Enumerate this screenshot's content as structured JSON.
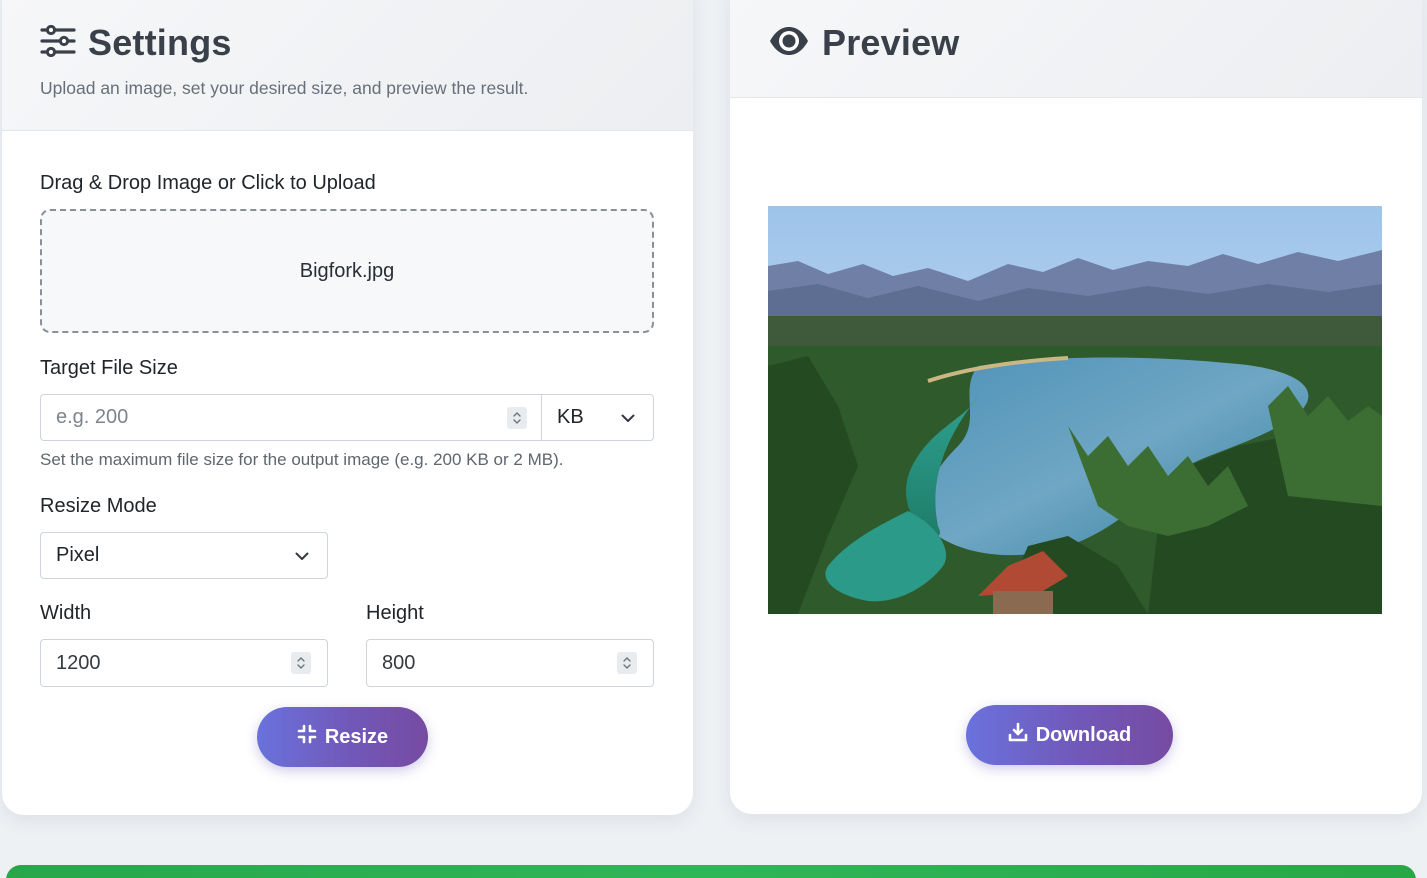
{
  "settings": {
    "title": "Settings",
    "subtitle": "Upload an image, set your desired size, and preview the result.",
    "upload_label": "Drag & Drop Image or Click to Upload",
    "uploaded_file": "Bigfork.jpg",
    "target_size_label": "Target File Size",
    "target_size_placeholder": "e.g. 200",
    "unit_value": "KB",
    "target_size_help": "Set the maximum file size for the output image (e.g. 200 KB or 2 MB).",
    "resize_mode_label": "Resize Mode",
    "resize_mode_value": "Pixel",
    "width_label": "Width",
    "width_value": "1200",
    "height_label": "Height",
    "height_value": "800",
    "resize_button": "Resize"
  },
  "preview": {
    "title": "Preview",
    "download_button": "Download"
  },
  "icons": {
    "settings": "sliders-icon",
    "preview": "eye-icon",
    "resize": "compress-icon",
    "download": "download-icon",
    "dropdown": "chevron-down-icon",
    "spinner": "spinner-arrows-icon"
  },
  "colors": {
    "accent_start": "#6a72dc",
    "accent_end": "#764ba2",
    "success_bar": "#28a745"
  }
}
